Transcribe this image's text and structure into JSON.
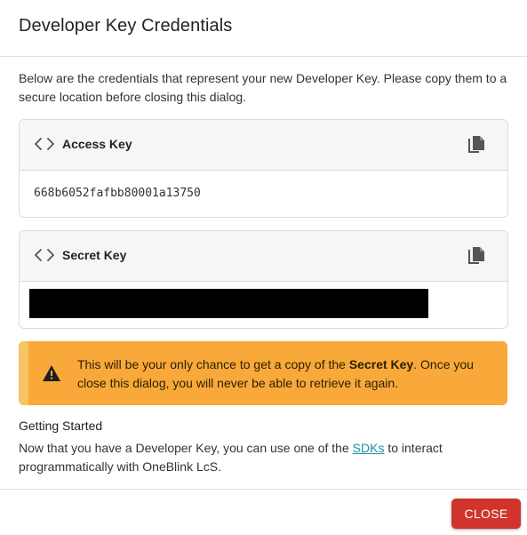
{
  "dialog": {
    "title": "Developer Key Credentials",
    "intro": "Below are the credentials that represent your new Developer Key. Please copy them to a secure location before closing this dialog."
  },
  "access_key": {
    "label": "Access Key",
    "value": "668b6052fafbb80001a13750",
    "icon": "code-icon",
    "copy_icon": "copy-icon"
  },
  "secret_key": {
    "label": "Secret Key",
    "value_state": "redacted",
    "icon": "code-icon",
    "copy_icon": "copy-icon"
  },
  "warning": {
    "text_before": "This will be your only chance to get a copy of the ",
    "text_bold": "Secret Key",
    "text_after": ". Once you close this dialog, you will never be able to retrieve it again.",
    "icon": "warning-icon",
    "color": "#f9a83a"
  },
  "getting_started": {
    "title": "Getting Started",
    "text_before": "Now that you have a Developer Key, you can use one of the ",
    "link_label": "SDKs",
    "text_after": " to interact programmatically with OneBlink LcS."
  },
  "footer": {
    "close_label": "CLOSE",
    "close_color": "#d0342c"
  }
}
